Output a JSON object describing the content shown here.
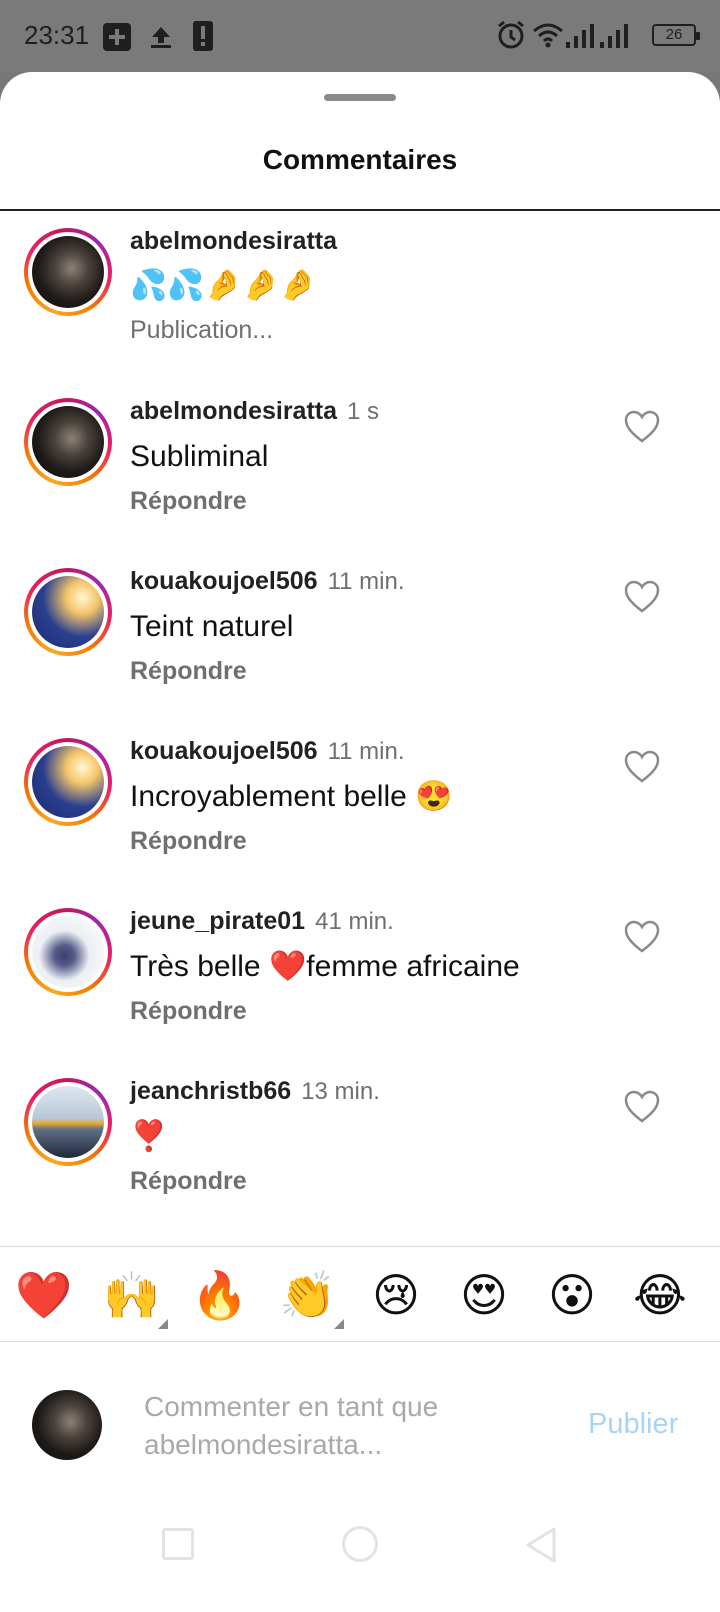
{
  "status_bar": {
    "time": "23:31",
    "battery": "26",
    "icons": [
      "add-box-icon",
      "upload-icon",
      "phone-sim-icon",
      "alarm-icon",
      "wifi-icon",
      "signal-icon",
      "signal-icon",
      "battery-icon"
    ]
  },
  "sheet": {
    "title": "Commentaires"
  },
  "caption": {
    "username": "abelmondesiratta",
    "text": "💦💦🤌🤌🤌",
    "meta": "Publication..."
  },
  "comments": [
    {
      "username": "abelmondesiratta",
      "time": "1 s",
      "text": "Subliminal",
      "reply": "Répondre",
      "avatar": "dark"
    },
    {
      "username": "kouakoujoel506",
      "time": "11 min.",
      "text": "Teint naturel",
      "reply": "Répondre",
      "avatar": "blue"
    },
    {
      "username": "kouakoujoel506",
      "time": "11 min.",
      "text": "Incroyablement belle 😍",
      "reply": "Répondre",
      "avatar": "blue"
    },
    {
      "username": "jeune_pirate01",
      "time": "41 min.",
      "text": "Très belle ❤️femme africaine",
      "reply": "Répondre",
      "avatar": "white"
    },
    {
      "username": "jeanchristb66",
      "time": "13 min.",
      "text": "❣️",
      "reply": "Répondre",
      "avatar": "sky"
    }
  ],
  "quick_reactions": [
    "❤️",
    "🙌",
    "🔥",
    "👏",
    "😢",
    "😍",
    "😮",
    "😂"
  ],
  "composer": {
    "placeholder": "Commenter en tant que abelmondesiratta...",
    "publish_label": "Publier"
  },
  "colors": {
    "publish_disabled": "#a8d4f5",
    "secondary_text": "#6f6f6f",
    "ring_start": "#f9a825",
    "ring_end": "#c2185b"
  }
}
